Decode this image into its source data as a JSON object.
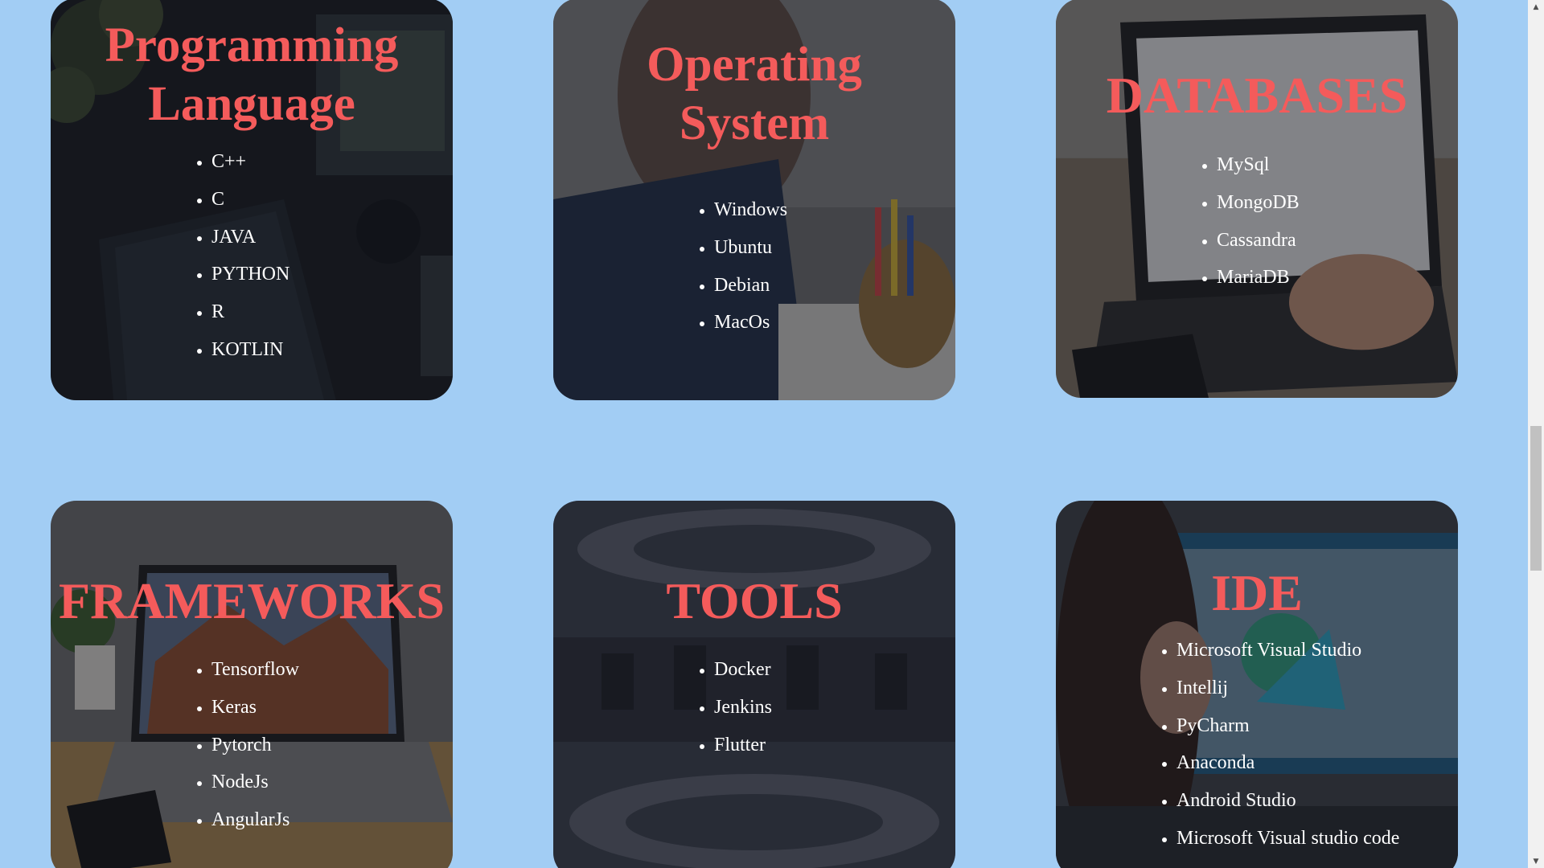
{
  "cards": {
    "programming": {
      "title_line1": "Programming",
      "title_line2": "Language",
      "items": [
        "C++",
        "C",
        "JAVA",
        "PYTHON",
        "R",
        "KOTLIN"
      ]
    },
    "os": {
      "title_line1": "Operating",
      "title_line2": "System",
      "items": [
        "Windows",
        "Ubuntu",
        "Debian",
        "MacOs"
      ]
    },
    "databases": {
      "title": "DATABASES",
      "items": [
        "MySql",
        "MongoDB",
        "Cassandra",
        "MariaDB"
      ]
    },
    "frameworks": {
      "title": "FRAMEWORKS",
      "items": [
        "Tensorflow",
        "Keras",
        "Pytorch",
        "NodeJs",
        "AngularJs"
      ]
    },
    "tools": {
      "title": "TOOLS",
      "items": [
        "Docker",
        "Jenkins",
        "Flutter"
      ]
    },
    "ide": {
      "title": "IDE",
      "items": [
        "Microsoft Visual Studio",
        "Intellij",
        "PyCharm",
        "Anaconda",
        "Android Studio",
        "Microsoft Visual studio code"
      ]
    }
  },
  "colors": {
    "page_background": "#a2cdf4",
    "title_color": "#f45b5b",
    "list_text": "#ffffff"
  },
  "icons": {
    "scroll_up": "▲",
    "scroll_down": "▼"
  }
}
